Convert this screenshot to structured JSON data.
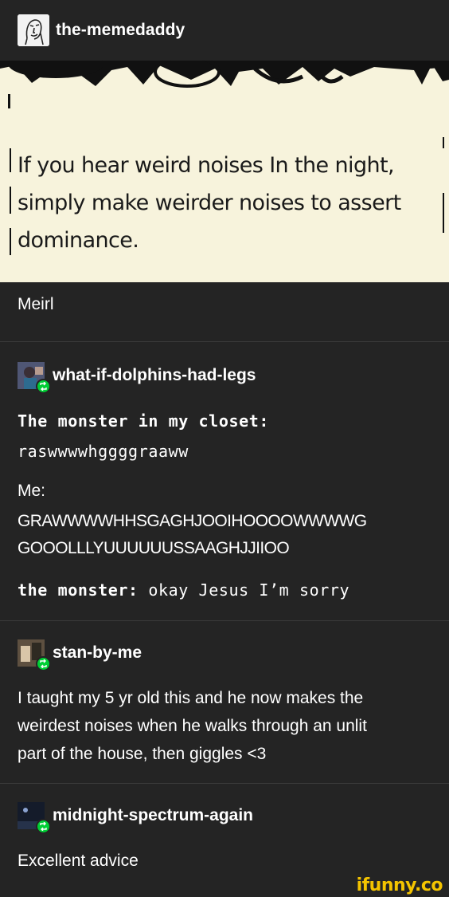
{
  "post": {
    "username": "the-memedaddy",
    "image_text": [
      "If you hear weird noises In the night,",
      "simply make weirder noises to assert",
      "dominance."
    ],
    "caption": "Meirl"
  },
  "reblogs": [
    {
      "username": "what-if-dolphins-had-legs",
      "lines": [
        {
          "bold": "The monster in my closet:",
          "text": ""
        },
        {
          "bold": "",
          "text": "raswwwwhggggraaww"
        }
      ],
      "me_label": "Me:",
      "me_lines": [
        "GRAWWWWHHSGAGHJOOIHOOOOWWWWG",
        "GOOOLLLYUUUUUUSSAAGHJJIIOO"
      ],
      "monster_bold": "the monster:",
      "monster_text": " okay Jesus I’m sorry"
    },
    {
      "username": "stan-by-me",
      "lines": [
        "I taught my 5 yr old this and he now makes the",
        "weirdest noises when he walks through an unlit",
        "part of the house, then giggles <3"
      ]
    },
    {
      "username": "midnight-spectrum-again",
      "text": "Excellent advice"
    }
  ],
  "watermark": "ifunny.co",
  "colors": {
    "background": "#242424",
    "meme_bg": "#f7f3dc",
    "reblog_badge": "#00cf35",
    "watermark": "#f4c400"
  },
  "icons": [
    "avatar-sketch-face",
    "reblog-icon"
  ]
}
